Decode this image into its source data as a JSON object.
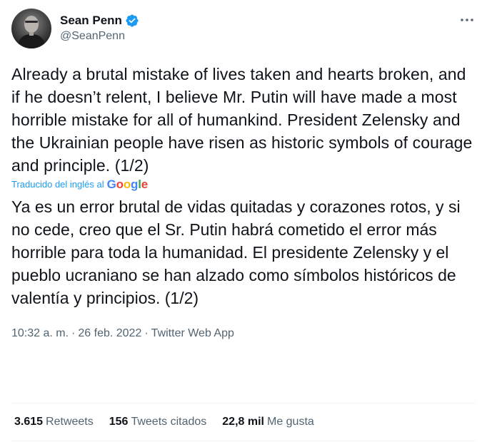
{
  "author": {
    "display_name": "Sean Penn",
    "handle": "@SeanPenn",
    "verified": true
  },
  "tweet": {
    "text": "Already a brutal mistake of lives taken and hearts broken, and if he doesn’t relent, I believe Mr. Putin will have made a most horrible mistake for all of humankind. President Zelensky and the Ukrainian people have risen as historic symbols of courage and principle. (1/2)",
    "translated_label": "Traducido del inglés al",
    "translator_brand": "Google",
    "translation": "Ya es un error brutal de vidas quitadas y corazones rotos, y si no cede, creo que el Sr. Putin habrá cometido el error más horrible para toda la humanidad. El presidente Zelensky y el pueblo ucraniano se han alzado como símbolos históricos de valentía y principios. (1/2)",
    "time": "10:32 a. m.",
    "date": "26 feb. 2022",
    "separator": "·",
    "source": "Twitter Web App"
  },
  "stats": {
    "retweets_count": "3.615",
    "retweets_label": "Retweets",
    "quotes_count": "156",
    "quotes_label": "Tweets citados",
    "likes_count": "22,8 mil",
    "likes_label": "Me gusta"
  },
  "colors": {
    "link": "#1d9bf0",
    "secondary_text": "#536471",
    "primary_text": "#0f1419",
    "verified": "#1d9bf0"
  }
}
